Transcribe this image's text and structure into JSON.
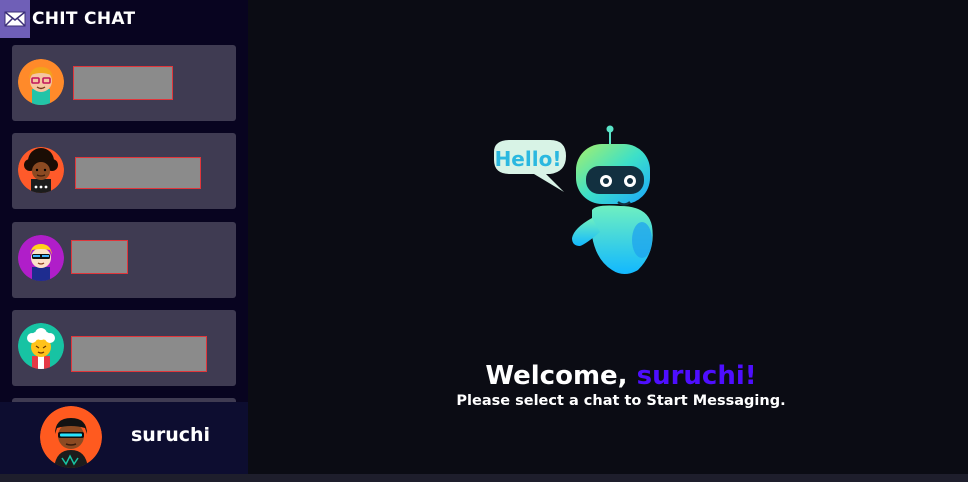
{
  "app": {
    "brand_title": "CHIT CHAT"
  },
  "contacts": [
    {
      "avatar_icon": "avatar-glasses-icon"
    },
    {
      "avatar_icon": "avatar-afro-icon"
    },
    {
      "avatar_icon": "avatar-sunglasses-icon"
    },
    {
      "avatar_icon": "avatar-white-hair-icon"
    }
  ],
  "current_user": {
    "username": "suruchi",
    "avatar_icon": "avatar-visor-icon"
  },
  "welcome": {
    "greeting": "Welcome, ",
    "username": "suruchi!",
    "subtitle": "Please select a chat to Start Messaging."
  },
  "robot": {
    "bubble_text": "Hello!"
  },
  "colors": {
    "sidebar_bg": "#080420",
    "contact_bg": "#3f3b52",
    "accent": "#4e0eff",
    "main_bg": "#0b0c14"
  }
}
